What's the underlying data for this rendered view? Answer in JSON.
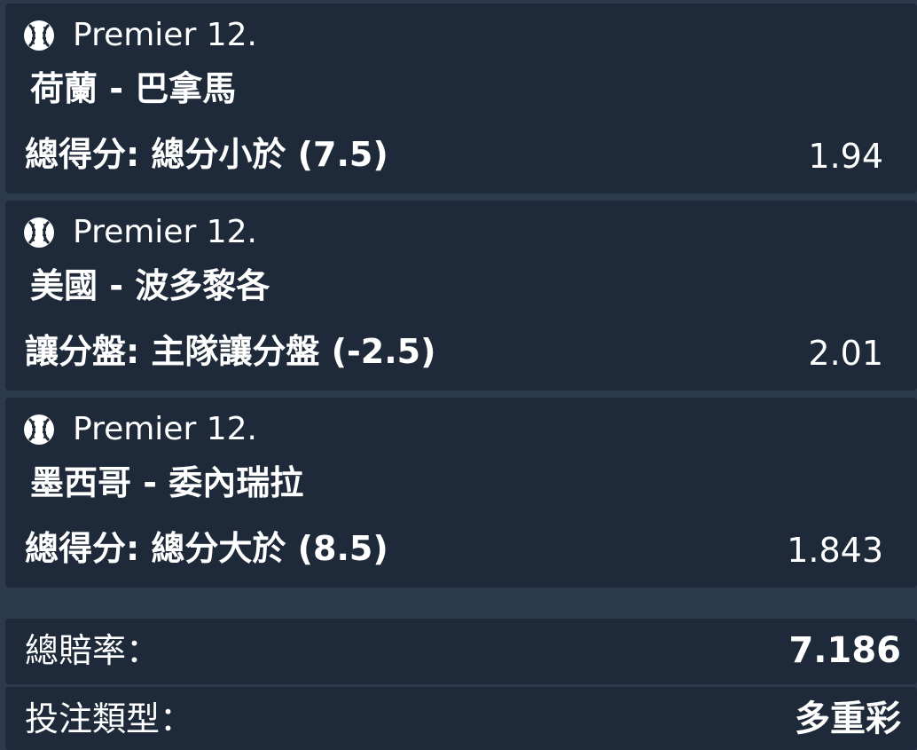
{
  "selections": [
    {
      "league": "Premier 12.",
      "match": "荷蘭 - 巴拿馬",
      "market": "總得分: 總分小於 (7.5)",
      "odds": "1.94",
      "icon": "baseball-icon"
    },
    {
      "league": "Premier 12.",
      "match": "美國 - 波多黎各",
      "market": "讓分盤: 主隊讓分盤 (-2.5)",
      "odds": "2.01",
      "icon": "baseball-icon"
    },
    {
      "league": "Premier 12.",
      "match": "墨西哥 - 委內瑞拉",
      "market": "總得分: 總分大於 (8.5)",
      "odds": "1.843",
      "icon": "baseball-icon"
    }
  ],
  "summary": {
    "total_odds_label": "總賠率：",
    "total_odds_value": "7.186",
    "bet_type_label": "投注類型：",
    "bet_type_value": "多重彩"
  },
  "colors": {
    "background": "#2b3a4c",
    "card": "#1e2a39",
    "text": "#ffffff"
  }
}
